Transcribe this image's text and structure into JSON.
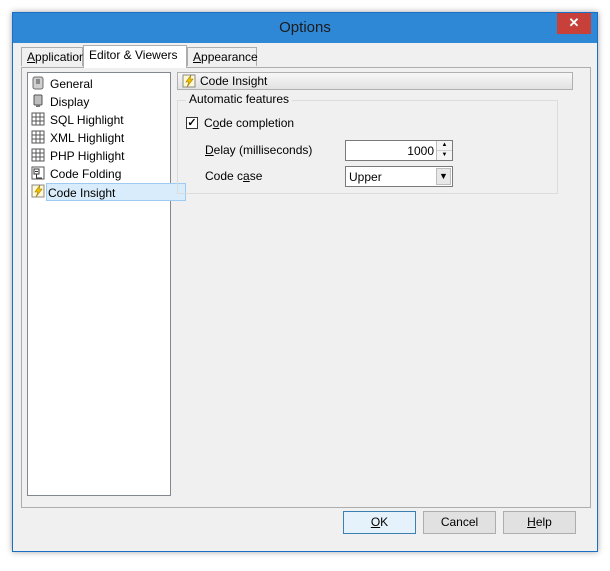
{
  "window": {
    "title": "Options",
    "close_glyph": "✕"
  },
  "tabs": [
    {
      "label_u": "A",
      "label_rest": "pplication"
    },
    {
      "label": "Editor & Viewers"
    },
    {
      "label_u": "A",
      "label_rest": "ppearance"
    }
  ],
  "tree": {
    "items": [
      {
        "label": "General",
        "icon": "general-icon"
      },
      {
        "label": "Display",
        "icon": "display-icon"
      },
      {
        "label": "SQL Highlight",
        "icon": "grid-icon"
      },
      {
        "label": "XML Highlight",
        "icon": "grid-icon"
      },
      {
        "label": "PHP Highlight",
        "icon": "grid-icon"
      },
      {
        "label": "Code Folding",
        "icon": "folding-icon"
      },
      {
        "label": "Code Insight",
        "icon": "lightning-icon",
        "selected": true
      }
    ]
  },
  "section": {
    "title": "Code Insight"
  },
  "group": {
    "title": "Automatic features",
    "code_completion": {
      "label_pre": "C",
      "label_u": "o",
      "label_post": "de completion",
      "checked": true,
      "check_glyph": "✓"
    },
    "delay": {
      "label_u": "D",
      "label_rest": "elay (milliseconds)",
      "value": "1000",
      "up_glyph": "▲",
      "down_glyph": "▼"
    },
    "code_case": {
      "label_pre": "Code c",
      "label_u": "a",
      "label_post": "se",
      "value": "Upper",
      "arrow_glyph": "▼"
    }
  },
  "buttons": {
    "ok": {
      "label_u": "O",
      "label_rest": "K"
    },
    "cancel": {
      "label": "Cancel"
    },
    "help": {
      "label_u": "H",
      "label_rest": "elp"
    }
  },
  "colors": {
    "accent": "#2f88d6",
    "close": "#c7413a",
    "selection": "#d9ecfb"
  }
}
